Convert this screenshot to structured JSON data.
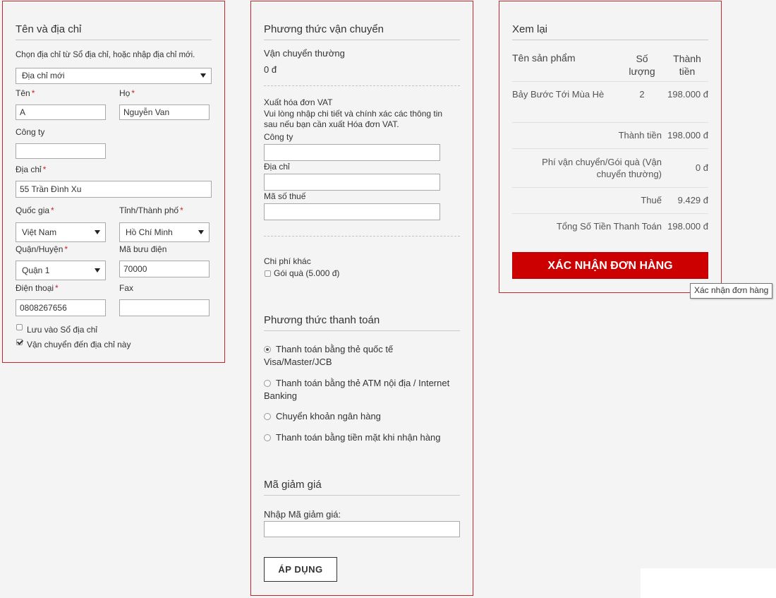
{
  "address": {
    "title": "Tên và địa chỉ",
    "hint": "Chọn địa chỉ từ Sổ địa chỉ, hoặc nhập địa chỉ mới.",
    "address_book_select": "Địa chỉ mới",
    "first_name_label": "Tên",
    "first_name_value": "A",
    "last_name_label": "Họ",
    "last_name_value": "Nguyễn Van",
    "company_label": "Công ty",
    "company_value": "",
    "street_label": "Địa chỉ",
    "street_value": "55 Trần Đình Xu",
    "country_label": "Quốc gia",
    "country_value": "Việt Nam",
    "province_label": "Tỉnh/Thành phố",
    "province_value": "Hồ Chí Minh",
    "district_label": "Quận/Huyện",
    "district_value": "Quận 1",
    "postcode_label": "Mã bưu điện",
    "postcode_value": "70000",
    "phone_label": "Điện thoại",
    "phone_value": "0808267656",
    "fax_label": "Fax",
    "fax_value": "",
    "save_to_book_label": "Lưu vào Sổ địa chỉ",
    "save_to_book_checked": false,
    "ship_here_label": "Vận chuyển đến địa chỉ này",
    "ship_here_checked": true,
    "required_mark": "*"
  },
  "shipping": {
    "title": "Phương thức vận chuyển",
    "method_name": "Vận chuyển thường",
    "method_price": "0 đ",
    "vat_title": "Xuất hóa đơn VAT",
    "vat_desc_line1": "Vui lòng nhập chi tiết và chính xác các thông tin",
    "vat_desc_line2": "sau nếu bạn cần xuất Hóa đơn VAT.",
    "vat_company_label": "Công ty",
    "vat_address_label": "Địa chỉ",
    "vat_tax_label": "Mã số thuế",
    "other_fees_title": "Chi phí khác",
    "gift_label": "Gói quà (5.000 đ)",
    "gift_checked": false
  },
  "payment": {
    "title": "Phương thức thanh toán",
    "options": [
      {
        "line1": "Thanh toán bằng thẻ quốc tế",
        "line2": "Visa/Master/JCB",
        "selected": true
      },
      {
        "line1": "Thanh toán bằng thẻ ATM nội địa / Internet",
        "line2": "Banking",
        "selected": false
      },
      {
        "line1": "Chuyển khoản ngân hàng",
        "line2": "",
        "selected": false
      },
      {
        "line1": "Thanh toán bằng tiền mặt khi nhận hàng",
        "line2": "",
        "selected": false
      }
    ]
  },
  "coupon": {
    "title": "Mã giảm giá",
    "label": "Nhập Mã giảm giá:",
    "value": "",
    "apply_label": "ÁP DỤNG"
  },
  "review": {
    "title": "Xem lại",
    "col_product": "Tên sản phẩm",
    "col_qty_line1": "Số",
    "col_qty_line2": "lượng",
    "col_total_line1": "Thành",
    "col_total_line2": "tiền",
    "items": [
      {
        "name": "Bảy Bước Tới Mùa Hè",
        "qty": "2",
        "total": "198.000 đ"
      }
    ],
    "subtotal_label": "Thành tiền",
    "subtotal_value": "198.000 đ",
    "shipping_label_line1": "Phí vận chuyển/Gói quà (Vận",
    "shipping_label_line2": "chuyển thường)",
    "shipping_value": "0 đ",
    "tax_label": "Thuế",
    "tax_value": "9.429 đ",
    "grand_total_label": "Tổng Số Tiền Thanh Toán",
    "grand_total_value": "198.000 đ",
    "confirm_label": "XÁC NHẬN ĐƠN HÀNG",
    "tooltip": "Xác nhận đơn hàng"
  },
  "colors": {
    "accent": "#c1272d",
    "confirm_button": "#cc0000"
  }
}
